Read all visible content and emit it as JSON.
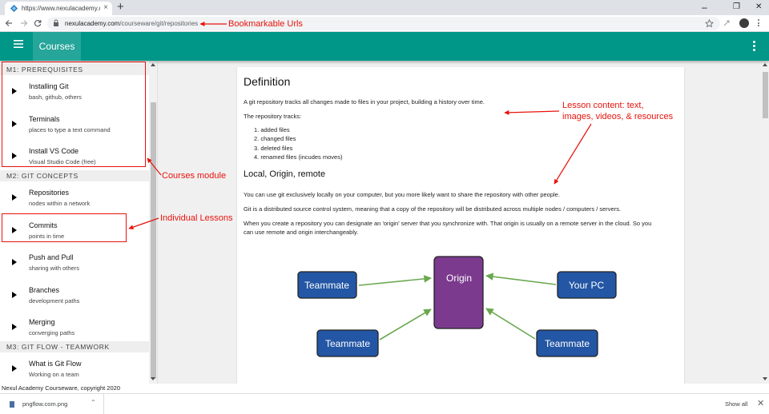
{
  "browser": {
    "tab_title": "https://www.nexulacademy.com",
    "new_tab_symbol": "+",
    "tab_close_symbol": "×",
    "url_domain": "nexulacademy.com",
    "url_path": "/courseware/git/repositories",
    "window_controls": {
      "minimize": "–",
      "restore": "❐",
      "close": "✕"
    }
  },
  "appbar": {
    "menu_icon": "hamburger-icon",
    "title": "Courses",
    "overflow_icon": "more-vert-icon",
    "color": "#009688"
  },
  "sidebar": {
    "modules": [
      {
        "title": "M1: PREREQUISITES"
      },
      {
        "title": "M2: GIT CONCEPTS"
      },
      {
        "title": "M3: GIT FLOW - TEAMWORK"
      }
    ],
    "lessons": [
      {
        "title": "Installing Git",
        "subtitle": "bash, github, others"
      },
      {
        "title": "Terminals",
        "subtitle": "places to type a text command"
      },
      {
        "title": "Install VS Code",
        "subtitle": "Visual Studio Code (free)"
      },
      {
        "title": "Repositories",
        "subtitle": "nodes within a network"
      },
      {
        "title": "Commits",
        "subtitle": "points in time"
      },
      {
        "title": "Push and Pull",
        "subtitle": "sharing with others"
      },
      {
        "title": "Branches",
        "subtitle": "development paths"
      },
      {
        "title": "Merging",
        "subtitle": "converging paths"
      },
      {
        "title": "What is Git Flow",
        "subtitle": "Working on a team"
      }
    ]
  },
  "content": {
    "heading": "Definition",
    "intro": "A git repository tracks all changes made to files in your project, building a history over time.",
    "tracks_label": "The repository tracks:",
    "tracks": [
      "added files",
      "changed files",
      "deleted files",
      "renamed files (incudes moves)"
    ],
    "subheading": "Local, Origin, remote",
    "para1": "You can use git exclusively locally on your computer, but you more likely want to share the repository with other people.",
    "para2": "Git is a distributed source control system, meaning that a copy of the repository will be distributed across multiple nodes / computers / servers.",
    "para3_line1": "When you create a repository you can designate an 'origin' server that you synchronize with. That origin is usually on a remote server in the cloud. So you",
    "para3_line2": "can use remote and origin interchangeably.",
    "diagram": {
      "origin": "Origin",
      "teammate_top_left": "Teammate",
      "your_pc": "Your PC",
      "teammate_bottom_left": "Teammate",
      "teammate_bottom_right": "Teammate",
      "node_color": "#2356a4",
      "origin_color": "#7b3a8e",
      "arrow_color": "#6aa84f"
    }
  },
  "footer": {
    "text": "Nexul Academy Courseware, copyright 2020"
  },
  "downloads": {
    "file": "pngflow.com.png",
    "chevron": "⌃",
    "show_all": "Show all",
    "close": "✕"
  },
  "annotations": {
    "bookmarkable": "Bookmarkable Urls",
    "lesson_content_line1": "Lesson content: text,",
    "lesson_content_line2": "images, videos, & resources",
    "courses_module": "Courses module",
    "individual_lessons": "Individual Lessons",
    "color": "#e8120c"
  }
}
